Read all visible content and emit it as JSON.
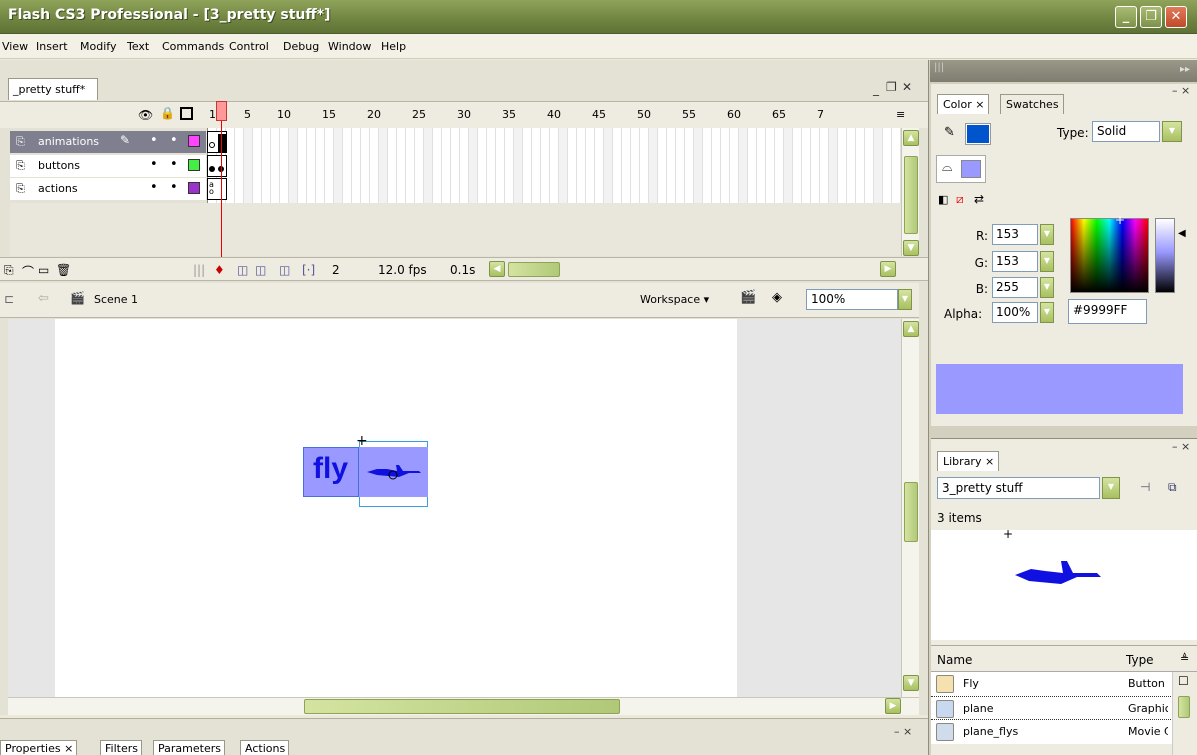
{
  "window": {
    "title": "Flash CS3 Professional - [3_pretty stuff*]",
    "min": "_",
    "restore": "❐",
    "close": "✕"
  },
  "menu": [
    "View",
    "Insert",
    "Modify",
    "Text",
    "Commands",
    "Control",
    "Debug",
    "Window",
    "Help"
  ],
  "document": {
    "tab_label": "_pretty stuff*",
    "panel_min": "_",
    "panel_restore": "❐",
    "panel_close": "✕"
  },
  "timeline": {
    "frame_numbers": [
      "1",
      "5",
      "10",
      "15",
      "20",
      "25",
      "30",
      "35",
      "40",
      "45",
      "50",
      "55",
      "60",
      "65",
      "7"
    ],
    "layers": [
      {
        "name": "animations",
        "color": "#ff44ff",
        "selected": true
      },
      {
        "name": "buttons",
        "color": "#44ee44",
        "selected": false
      },
      {
        "name": "actions",
        "color": "#9933cc",
        "selected": false
      }
    ],
    "current_frame": "2",
    "fps": "12.0 fps",
    "elapsed": "0.1s"
  },
  "editbar": {
    "scene": "Scene 1",
    "workspace": "Workspace ▾",
    "zoom": "100%"
  },
  "stage": {
    "button_text": "fly"
  },
  "bottom_tabs": [
    "Properties",
    "Filters",
    "Parameters",
    "Actions"
  ],
  "color_panel": {
    "tabs": [
      "Color",
      "Swatches"
    ],
    "type_label": "Type:",
    "type_value": "Solid",
    "r_label": "R:",
    "r_value": "153",
    "g_label": "G:",
    "g_value": "153",
    "b_label": "B:",
    "b_value": "255",
    "alpha_label": "Alpha:",
    "alpha_value": "100%",
    "hex_value": "#9999FF",
    "stroke_color": "#0055cc",
    "fill_color": "#9999ff"
  },
  "library": {
    "tab": "Library",
    "document": "3_pretty stuff",
    "count": "3 items",
    "col_name": "Name",
    "col_type": "Type",
    "items": [
      {
        "name": "Fly",
        "type": "Button"
      },
      {
        "name": "plane",
        "type": "Graphic"
      },
      {
        "name": "plane_flys",
        "type": "Movie Clip"
      }
    ]
  }
}
